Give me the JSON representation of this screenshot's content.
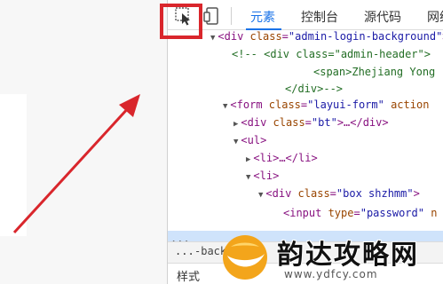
{
  "devtools": {
    "tabs": {
      "elements": "元素",
      "console": "控制台",
      "sources": "源代码",
      "network": "网络"
    },
    "dom_lines": [
      {
        "tri": "▼",
        "tag_open": "<div ",
        "attr": "class",
        "eq": "=",
        "val": "\"admin-login-background\"",
        "tag_close": ">"
      },
      {
        "cmt": "<!-- <div class=\"admin-header\">"
      },
      {
        "cmt": "<span>Zhejiang Yong"
      },
      {
        "cmt": "</div>-->"
      },
      {
        "tri": "▼",
        "tag_open": "<form ",
        "attr": "class",
        "eq": "=",
        "val": "\"layui-form\"",
        "rest": " action"
      },
      {
        "tri": "▶",
        "tag_open": "<div ",
        "attr": "class",
        "eq": "=",
        "val": "\"bt\"",
        "tag_close": ">…</div>"
      },
      {
        "tri": "▼",
        "tag_open": "<ul>"
      },
      {
        "tri": "▶",
        "tag_open": "<li>…</li>"
      },
      {
        "tri": "▼",
        "tag_open": "<li>"
      },
      {
        "tri": "▼",
        "tag_open": "<div ",
        "attr": "class",
        "eq": "=",
        "val": "\"box shzhmm\"",
        "tag_close": ">"
      },
      {
        "tag_open": "<input ",
        "attr": "type",
        "eq": "=",
        "val": "\"password\"",
        "rest": " n"
      }
    ],
    "row_dots": "...",
    "breadcrumb_dots": "...",
    "breadcrumb_item": "-back",
    "styles_tab": "样式"
  },
  "watermark": {
    "title": "韵达攻略网",
    "url": "www.ydfcy.com"
  },
  "colors": {
    "highlight": "#d9262c",
    "arrow": "#d9262c",
    "selected_row": "#cfe3fb",
    "active_tab": "#1a73e8"
  },
  "icons": [
    "inspect-cursor-icon",
    "device-toggle-icon",
    "red-arrow",
    "watermark-logo"
  ]
}
